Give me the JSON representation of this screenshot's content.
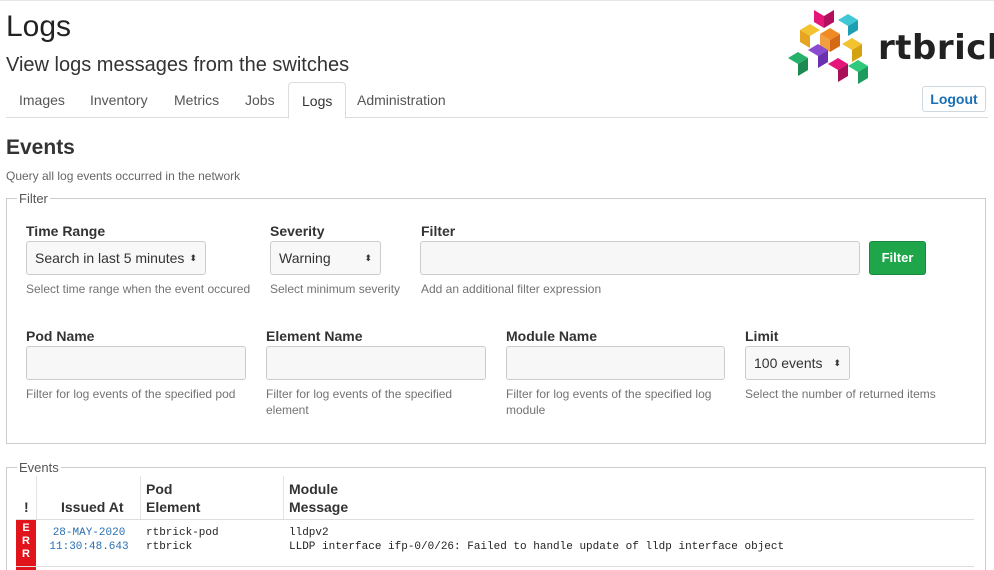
{
  "header": {
    "title": "Logs",
    "subtitle": "View logs messages from the switches",
    "logo_text": "rtbrick",
    "logout_label": "Logout"
  },
  "nav": {
    "tabs": [
      {
        "label": "Images",
        "active": false
      },
      {
        "label": "Inventory",
        "active": false
      },
      {
        "label": "Metrics",
        "active": false
      },
      {
        "label": "Jobs",
        "active": false
      },
      {
        "label": "Logs",
        "active": true
      },
      {
        "label": "Administration",
        "active": false
      }
    ]
  },
  "events_section": {
    "title": "Events",
    "description": "Query all log events occurred in the network"
  },
  "filter": {
    "legend": "Filter",
    "time_range": {
      "label": "Time Range",
      "value": "Search in last 5 minutes",
      "help": "Select time range when the event occured"
    },
    "severity": {
      "label": "Severity",
      "value": "Warning",
      "help": "Select minimum severity"
    },
    "expression": {
      "label": "Filter",
      "value": "",
      "help": "Add an additional filter expression"
    },
    "filter_button": "Filter",
    "pod_name": {
      "label": "Pod Name",
      "value": "",
      "help": "Filter for log events of the specified pod"
    },
    "element_name": {
      "label": "Element Name",
      "value": "",
      "help_line1": "Filter for log events of the specified",
      "help_line2": "element"
    },
    "module_name": {
      "label": "Module Name",
      "value": "",
      "help_line1": "Filter for log events of the specified log",
      "help_line2": "module"
    },
    "limit": {
      "label": "Limit",
      "value": "100 events",
      "help": "Select the number of returned items"
    }
  },
  "events_table": {
    "legend": "Events",
    "headers": {
      "severity": "!",
      "issued_at": "Issued At",
      "pod": "Pod",
      "element": "Element",
      "module": "Module",
      "message": "Message"
    },
    "rows": [
      {
        "severity": "ERR",
        "date": "28-MAY-2020",
        "time": "11:30:48.643",
        "pod": "rtbrick-pod",
        "element": "rtbrick",
        "module": "lldpv2",
        "message": "LLDP interface ifp-0/0/26: Failed to handle update of lldp interface object"
      }
    ]
  },
  "colors": {
    "accent_link": "#1a6fb5",
    "filter_button": "#1fa64b",
    "error_badge": "#e0141a"
  }
}
